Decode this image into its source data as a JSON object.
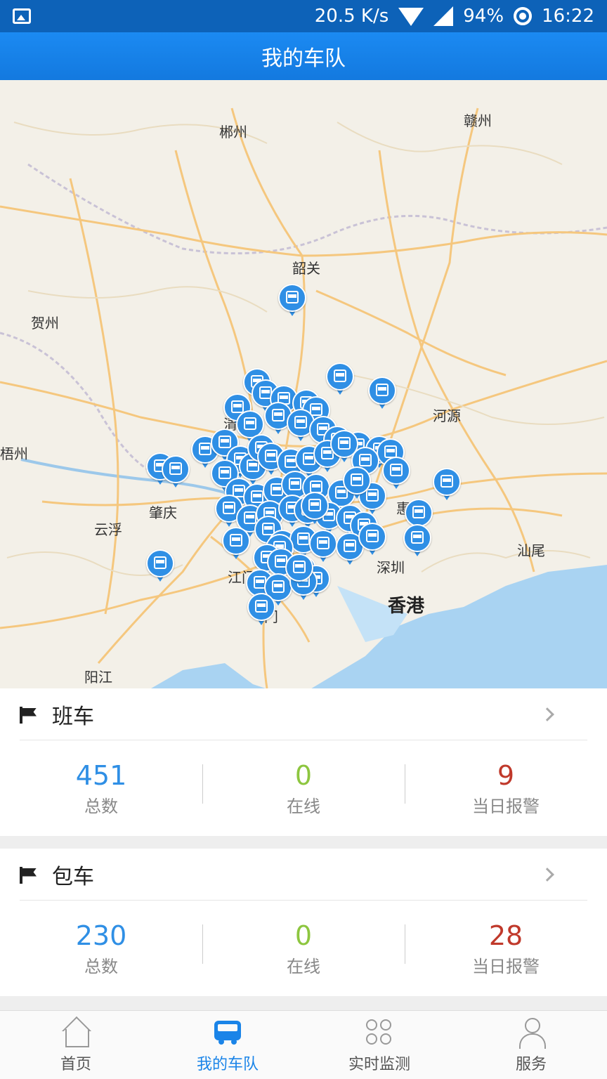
{
  "status_bar": {
    "speed": "20.5 K/s",
    "battery": "94%",
    "time": "16:22",
    "icons": [
      "gallery-icon",
      "wifi-icon",
      "signal-icon",
      "sync-icon"
    ]
  },
  "header": {
    "title": "我的车队"
  },
  "map": {
    "cities": [
      "郴州",
      "赣州",
      "韶关",
      "贺州",
      "河源",
      "梧州",
      "肇庆",
      "云浮",
      "惠",
      "汕尾",
      "江门",
      "深圳",
      "香港",
      "门",
      "阳江",
      "清"
    ],
    "marker_icon": "bus-marker-icon",
    "colors": {
      "marker": "#2f8fe5",
      "land": "#f3f0e8",
      "sea": "#a9d3f2",
      "roads": "#f5c77e"
    }
  },
  "sections": [
    {
      "title": "班车",
      "stats": [
        {
          "value": "451",
          "label": "总数"
        },
        {
          "value": "0",
          "label": "在线"
        },
        {
          "value": "9",
          "label": "当日报警"
        }
      ]
    },
    {
      "title": "包车",
      "stats": [
        {
          "value": "230",
          "label": "总数"
        },
        {
          "value": "0",
          "label": "在线"
        },
        {
          "value": "28",
          "label": "当日报警"
        }
      ]
    }
  ],
  "colors": {
    "total": "#2f8fe5",
    "online": "#8dc63f",
    "alarm": "#c0392b",
    "accent": "#1a84e8"
  },
  "bottom_nav": [
    {
      "label": "首页",
      "icon": "home-icon",
      "active": false
    },
    {
      "label": "我的车队",
      "icon": "bus-icon",
      "active": true
    },
    {
      "label": "实时监测",
      "icon": "grid-icon",
      "active": false
    },
    {
      "label": "服务",
      "icon": "user-icon",
      "active": false
    }
  ]
}
